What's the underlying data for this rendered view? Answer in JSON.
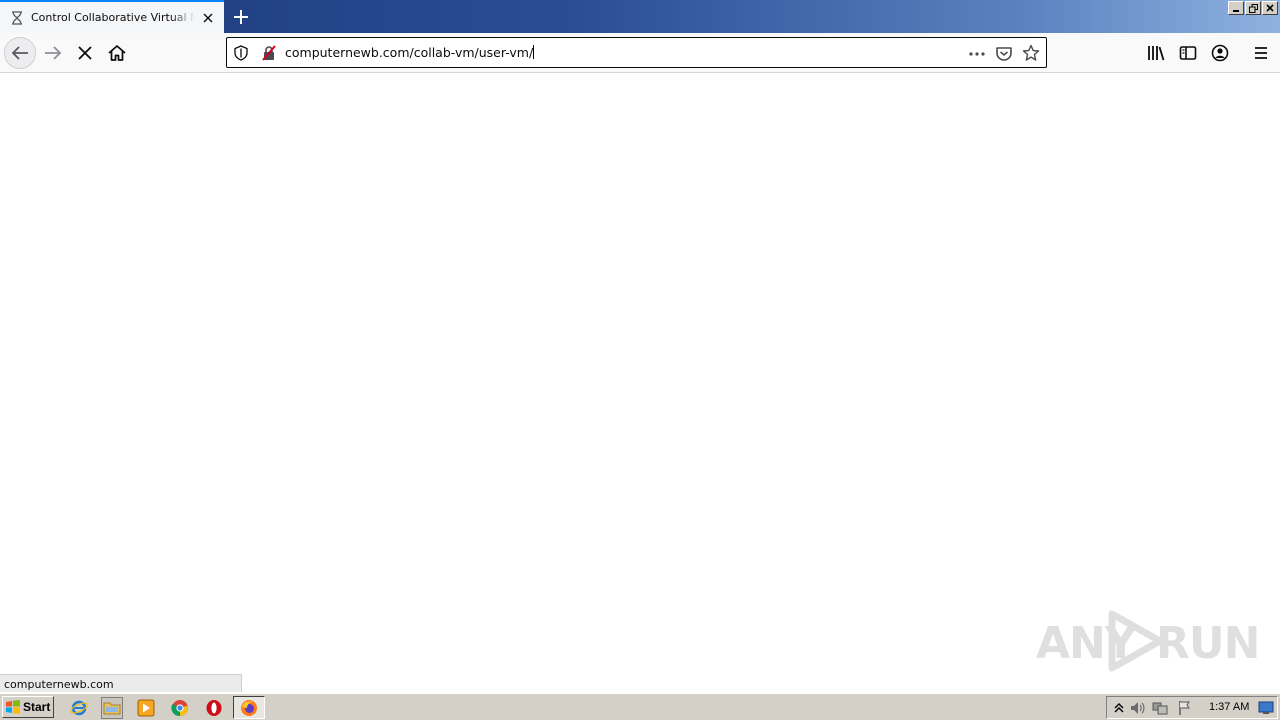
{
  "tab": {
    "title": "Control Collaborative Virtual Machines",
    "favicon": "hourglass-icon",
    "close": "close-icon"
  },
  "toolbar": {
    "back": "back-arrow-icon",
    "forward": "forward-arrow-icon",
    "stop": "stop-icon",
    "home": "home-icon",
    "url": "computernewb.com/collab-vm/user-vm/",
    "right_icons": [
      "library-icon",
      "sidebar-icon",
      "account-icon",
      "hamburger-menu-icon"
    ]
  },
  "status": {
    "text": "computernewb.com"
  },
  "watermark": {
    "left": "ANY",
    "right": "RUN"
  },
  "taskbar": {
    "start_label": "Start",
    "clock": "1:37 AM",
    "quick_launch": [
      "internet-explorer-icon",
      "explorer-folder-icon",
      "media-player-icon",
      "chrome-icon",
      "opera-icon"
    ],
    "active_app": "firefox-icon"
  },
  "colors": {
    "accent": "#0a84ff",
    "titlebar_start": "#1c3a7a",
    "titlebar_end": "#8fb2e0",
    "taskbar": "#d4d0c8"
  }
}
